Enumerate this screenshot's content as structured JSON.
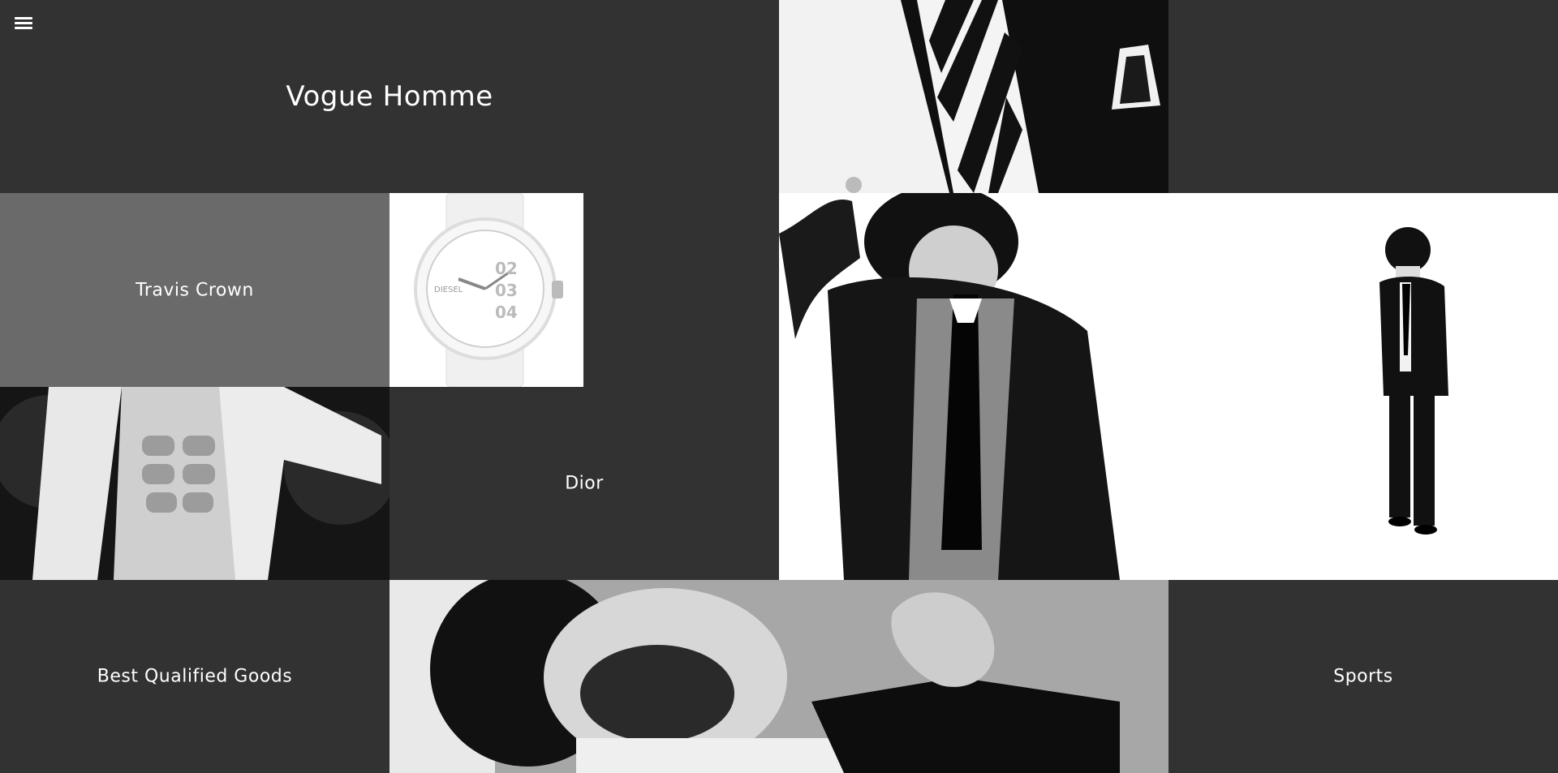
{
  "site": {
    "title": "Vogue Homme",
    "menu_icon": "hamburger-menu-icon"
  },
  "tiles": {
    "travis_crown": "Travis Crown",
    "dior": "Dior",
    "best_goods": "Best Qualified Goods",
    "sports": "Sports"
  },
  "images": {
    "watch_brand": "DIESEL",
    "watch_numbers": [
      "02",
      "03",
      "04"
    ]
  },
  "colors": {
    "background": "#323232",
    "tile_gray": "#6a6a6a",
    "text": "#ffffff"
  }
}
